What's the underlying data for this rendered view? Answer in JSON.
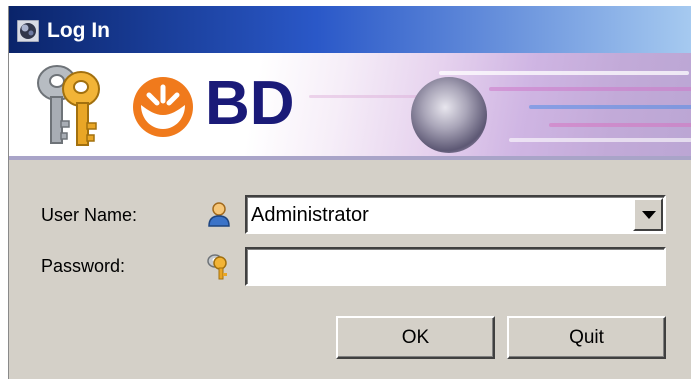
{
  "window": {
    "title": "Log In",
    "title_icon": "app-icon"
  },
  "banner": {
    "logo_text": "BD",
    "logo_icon": "bd-sunburst-logo",
    "keys_icon": "keys-icon"
  },
  "form": {
    "username_label": "User Name:",
    "username_icon": "user-icon",
    "username_value": "Administrator",
    "password_label": "Password:",
    "password_icon": "key-icon",
    "password_value": ""
  },
  "buttons": {
    "ok_label": "OK",
    "quit_label": "Quit"
  },
  "colors": {
    "titlebar_start": "#0a246a",
    "titlebar_end": "#a6caf0",
    "dialog_bg": "#d4d0c8",
    "brand_orange": "#f07a1c",
    "brand_blue": "#1a1a78"
  }
}
